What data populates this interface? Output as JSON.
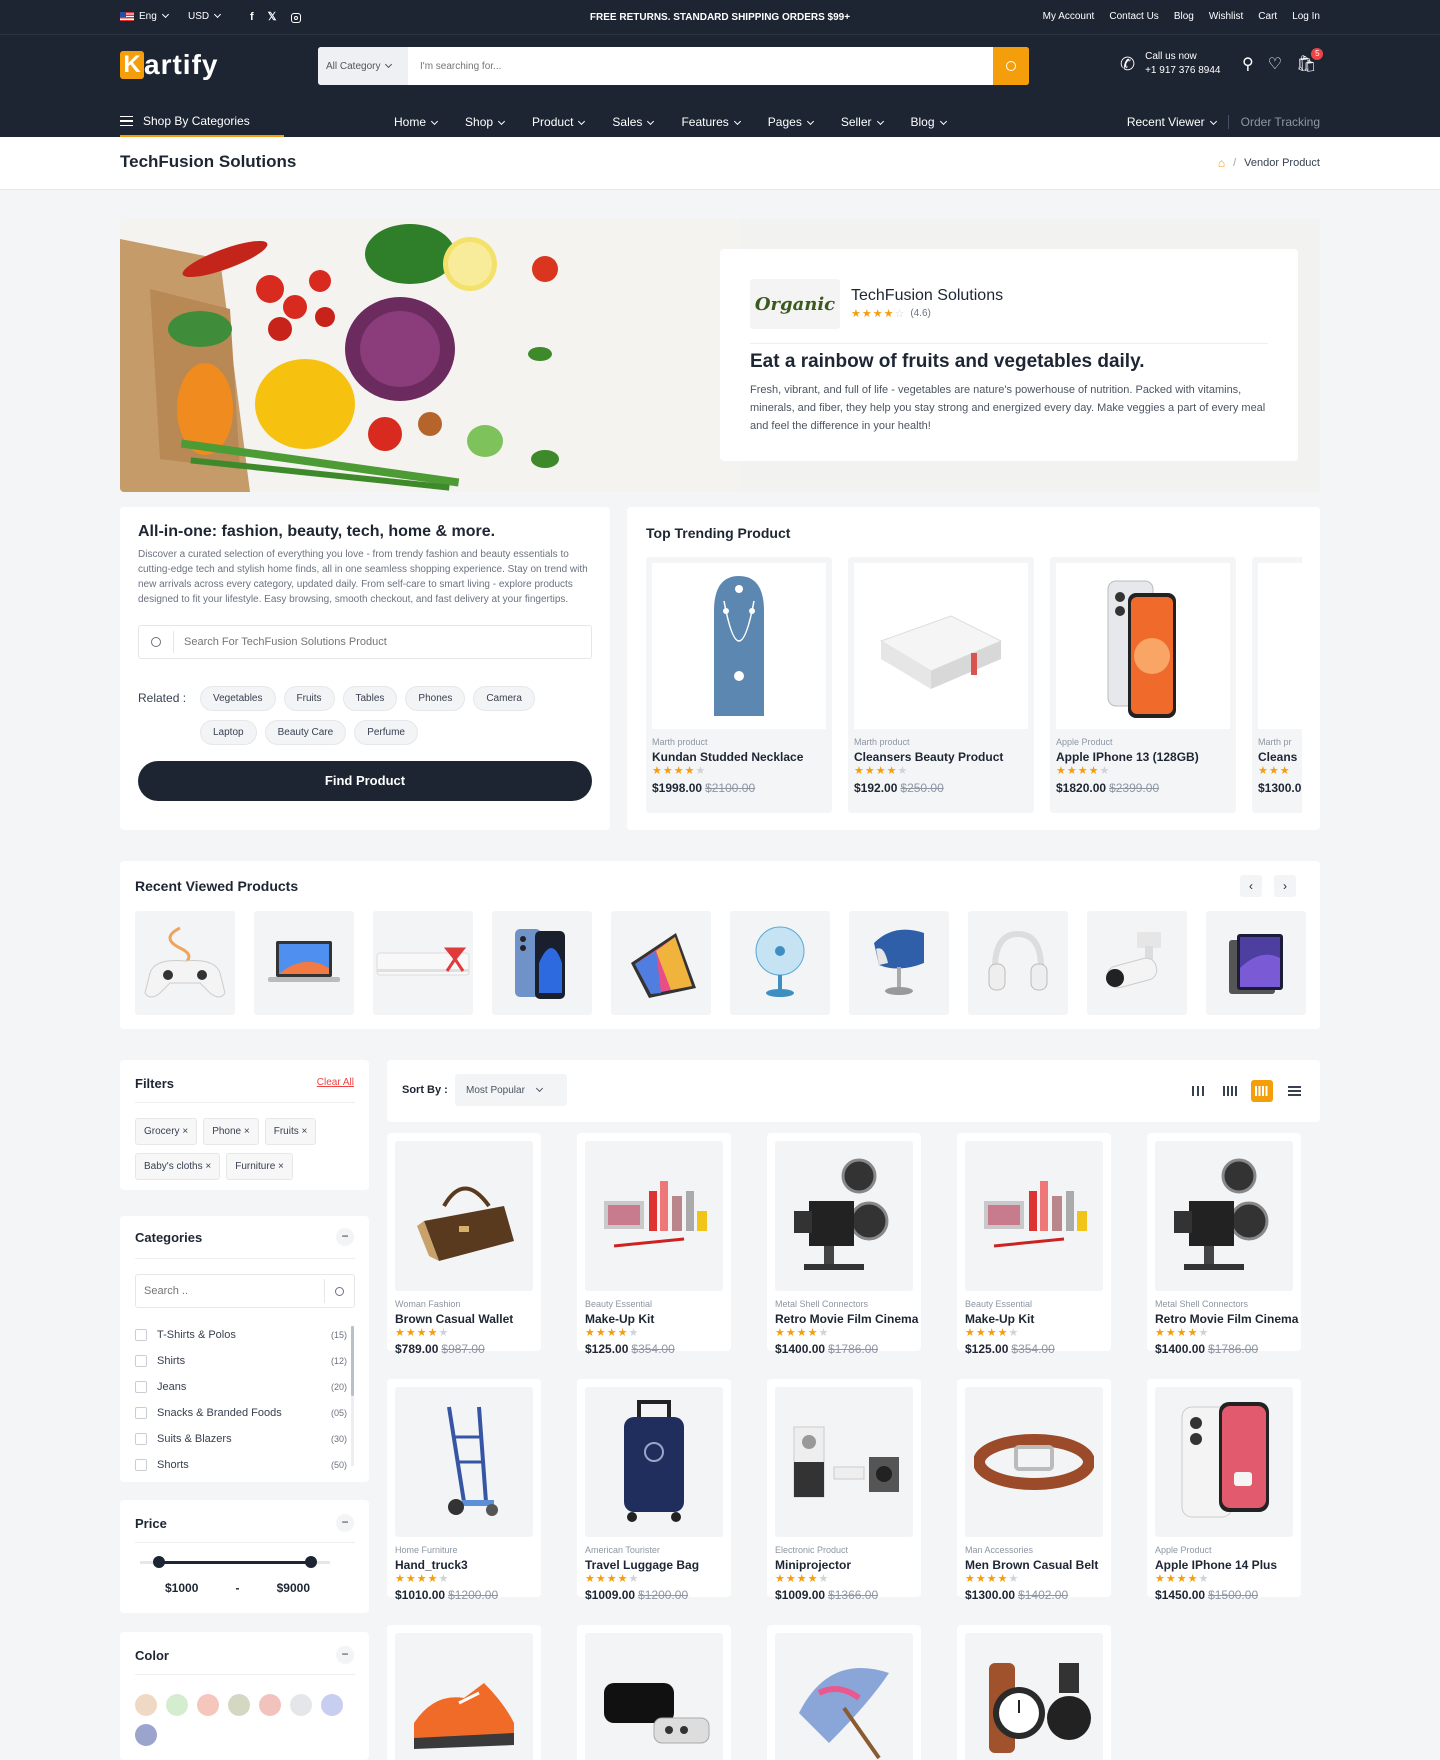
{
  "topbar": {
    "lang": "Eng",
    "currency": "USD",
    "promo": "FREE RETURNS. STANDARD SHIPPING ORDERS $99+",
    "links": [
      "My Account",
      "Contact Us",
      "Blog",
      "Wishlist",
      "Cart",
      "Log In"
    ]
  },
  "header": {
    "logo": "Kartify",
    "category_select": "All Category",
    "search_placeholder": "I'm searching for...",
    "call_label": "Call us now",
    "phone": "+1 917 376 8944",
    "cart_count": "5"
  },
  "nav": {
    "shop_by": "Shop By Categories",
    "items": [
      "Home",
      "Shop",
      "Product",
      "Sales",
      "Features",
      "Pages",
      "Seller",
      "Blog"
    ],
    "recent": "Recent Viewer",
    "order": "Order Tracking"
  },
  "breadcrumb": {
    "title": "TechFusion Solutions",
    "current": "Vendor Product"
  },
  "vendor": {
    "logo_text": "Organic",
    "name": "TechFusion Solutions",
    "rating": "(4.6)",
    "headline": "Eat a rainbow of fruits and vegetables daily.",
    "desc": "Fresh, vibrant, and full of life - vegetables are nature's powerhouse of nutrition. Packed with vitamins, minerals, and fiber, they help you stay strong and energized every day. Make veggies a part of every meal and feel the difference in your health!"
  },
  "about": {
    "title": "All-in-one: fashion, beauty, tech, home & more.",
    "desc": "Discover a curated selection of everything you love - from trendy fashion and beauty essentials to cutting-edge tech and stylish home finds, all in one seamless shopping experience. Stay on trend with new arrivals across every category, updated daily. From self-care to smart living - explore products designed to fit your lifestyle. Easy browsing, smooth checkout, and fast delivery at your fingertips.",
    "search_placeholder": "Search For TechFusion Solutions Product",
    "related_label": "Related :",
    "related": [
      "Vegetables",
      "Fruits",
      "Tables",
      "Phones",
      "Camera",
      "Laptop",
      "Beauty Care",
      "Perfume"
    ],
    "button": "Find Product"
  },
  "trending": {
    "title": "Top Trending Product",
    "items": [
      {
        "cat": "Marth product",
        "name": "Kundan Studded Necklace",
        "price": "$1998.00",
        "old": "$2100.00"
      },
      {
        "cat": "Marth product",
        "name": "Cleansers Beauty Product",
        "price": "$192.00",
        "old": "$250.00"
      },
      {
        "cat": "Apple Product",
        "name": "Apple IPhone 13 (128GB)",
        "price": "$1820.00",
        "old": "$2399.00"
      },
      {
        "cat": "Marth pr",
        "name": "Cleans",
        "price": "$1300.0",
        "old": ""
      }
    ]
  },
  "recent": {
    "title": "Recent Viewed Products",
    "icons": [
      "gamepad-icon",
      "laptop-icon",
      "air-conditioner-icon",
      "phone-icon",
      "tablet-icon",
      "fan-icon",
      "chair-icon",
      "headphones-icon",
      "camera-icon",
      "ipad-icon"
    ]
  },
  "filters": {
    "title": "Filters",
    "clear": "Clear All",
    "chips": [
      "Grocery",
      "Phone",
      "Fruits",
      "Baby's cloths",
      "Furniture"
    ]
  },
  "categories": {
    "title": "Categories",
    "search_placeholder": "Search ..",
    "items": [
      {
        "name": "T-Shirts & Polos",
        "count": "(15)"
      },
      {
        "name": "Shirts",
        "count": "(12)"
      },
      {
        "name": "Jeans",
        "count": "(20)"
      },
      {
        "name": "Snacks & Branded Foods",
        "count": "(05)"
      },
      {
        "name": "Suits & Blazers",
        "count": "(30)"
      },
      {
        "name": "Shorts",
        "count": "(50)"
      }
    ]
  },
  "price": {
    "title": "Price",
    "min": "$1000",
    "sep": "-",
    "max": "$9000",
    "min_fraction": 0.1,
    "max_fraction": 0.9
  },
  "color": {
    "title": "Color",
    "swatches": [
      "#f0d9c4",
      "#d5edcf",
      "#f5c6bb",
      "#d4d8c3",
      "#f2c3bd",
      "#e4e6e9",
      "#c8cef0",
      "#9aa4cc"
    ]
  },
  "sort": {
    "label": "Sort By :",
    "value": "Most Popular"
  },
  "products": [
    {
      "cat": "Woman Fashion",
      "name": "Brown Casual Wallet",
      "price": "$789.00",
      "old": "$987.00",
      "icon": "wallet-icon"
    },
    {
      "cat": "Beauty Essential",
      "name": "Make-Up Kit",
      "price": "$125.00",
      "old": "$354.00",
      "icon": "makeup-icon"
    },
    {
      "cat": "Metal Shell Connectors",
      "name": "Retro Movie Film Cinema",
      "price": "$1400.00",
      "old": "$1786.00",
      "icon": "projector-icon"
    },
    {
      "cat": "Beauty Essential",
      "name": "Make-Up Kit",
      "price": "$125.00",
      "old": "$354.00",
      "icon": "makeup-icon"
    },
    {
      "cat": "Metal Shell Connectors",
      "name": "Retro Movie Film Cinema",
      "price": "$1400.00",
      "old": "$1786.00",
      "icon": "projector-icon"
    },
    {
      "cat": "Home Furniture",
      "name": "Hand_truck3",
      "price": "$1010.00",
      "old": "$1200.00",
      "icon": "hand-truck-icon"
    },
    {
      "cat": "American Tourister",
      "name": "Travel Luggage Bag",
      "price": "$1009.00",
      "old": "$1200.00",
      "icon": "luggage-icon"
    },
    {
      "cat": "Electronic Product",
      "name": "Miniprojector",
      "price": "$1009.00",
      "old": "$1366.00",
      "icon": "miniprojector-icon"
    },
    {
      "cat": "Man Accessories",
      "name": "Men Brown Casual Belt",
      "price": "$1300.00",
      "old": "$1402.00",
      "icon": "belt-icon"
    },
    {
      "cat": "Apple Product",
      "name": "Apple IPhone 14 Plus",
      "price": "$1450.00",
      "old": "$1500.00",
      "icon": "iphone-icon"
    },
    {
      "icon": "shoe-icon"
    },
    {
      "icon": "apple-tv-icon"
    },
    {
      "icon": "umbrella-icon"
    },
    {
      "icon": "watch-icon"
    }
  ]
}
